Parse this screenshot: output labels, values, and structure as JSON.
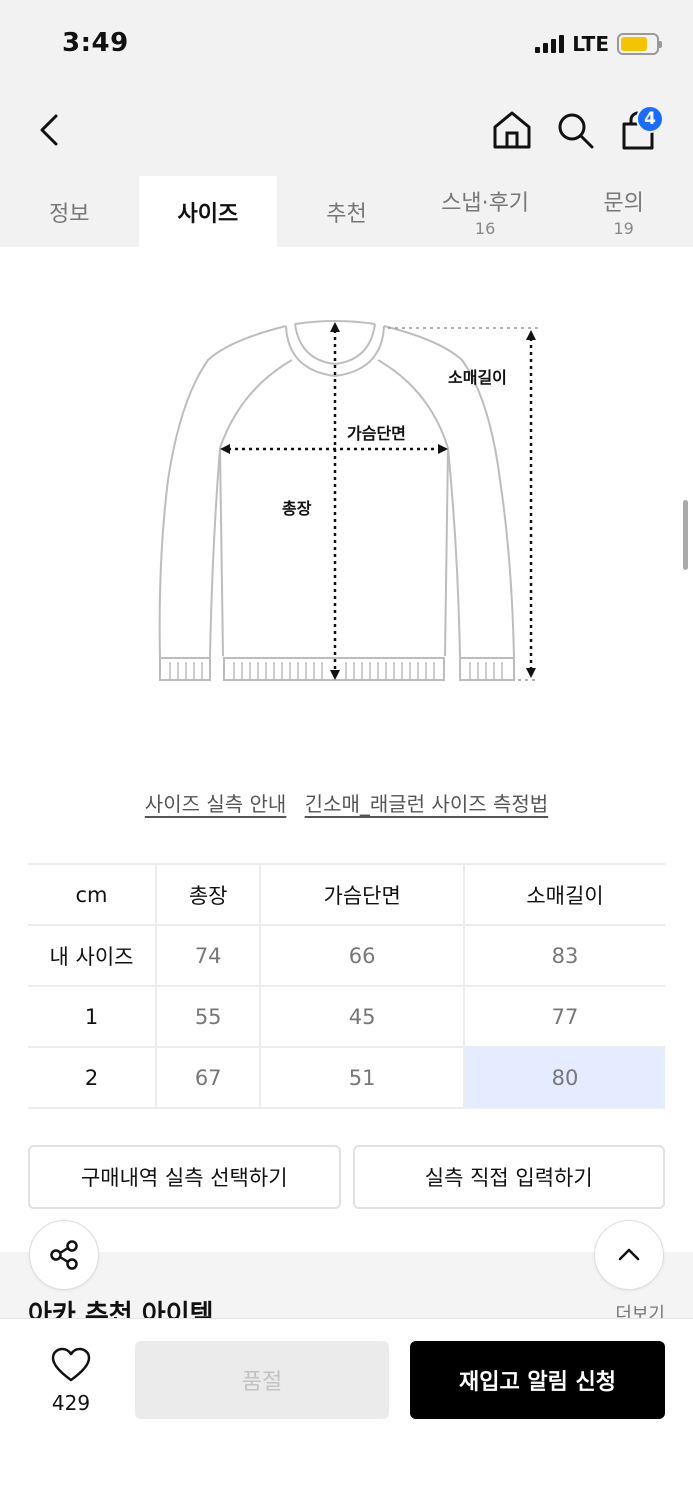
{
  "status": {
    "time": "3:49",
    "network": "LTE",
    "battery_color": "#f5c400"
  },
  "nav": {
    "cart_count": "4",
    "accent": "#1a6cff"
  },
  "tabs": [
    {
      "label": "정보",
      "count": ""
    },
    {
      "label": "사이즈",
      "count": "",
      "active": true
    },
    {
      "label": "추천",
      "count": ""
    },
    {
      "label": "스냅·후기",
      "count": "16"
    },
    {
      "label": "문의",
      "count": "19"
    }
  ],
  "diagram": {
    "sleeve_label": "소매길이",
    "chest_label": "가슴단면",
    "length_label": "총장"
  },
  "guide": {
    "link1": "사이즈 실측 안내",
    "link2": "긴소매_래글런 사이즈 측정법"
  },
  "size_table": {
    "headers": [
      "cm",
      "총장",
      "가슴단면",
      "소매길이"
    ],
    "rows": [
      [
        "내 사이즈",
        "74",
        "66",
        "83"
      ],
      [
        "1",
        "55",
        "45",
        "77"
      ],
      [
        "2",
        "67",
        "51",
        "80"
      ]
    ],
    "highlight_color": "#e6ecff"
  },
  "actions": {
    "purchase_history": "구매내역 실측 선택하기",
    "direct_input": "실측 직접 입력하기"
  },
  "recommend": {
    "title": "아카 추천 아이템",
    "more": "더보기"
  },
  "bottom": {
    "like_count": "429",
    "soldout": "품절",
    "restock": "재입고 알림 신청"
  }
}
